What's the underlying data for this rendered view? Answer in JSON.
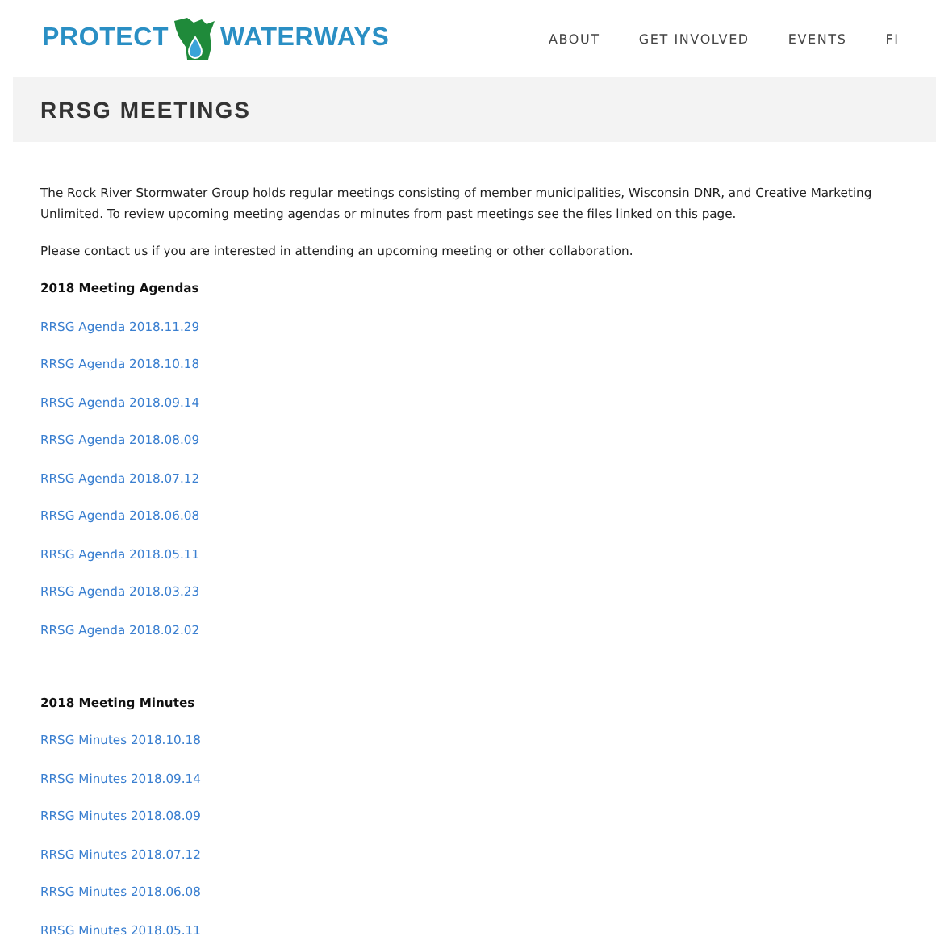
{
  "header": {
    "logo_left": "PROTECT",
    "logo_right": "WATERWAYS",
    "nav": [
      "ABOUT",
      "GET INVOLVED",
      "EVENTS",
      "FI"
    ]
  },
  "page_title": "RRSG MEETINGS",
  "intro": "The Rock River Stormwater Group holds regular meetings consisting of member municipalities, Wisconsin DNR, and Creative Marketing Unlimited. To review upcoming meeting agendas or minutes from past meetings see the files linked on this page.",
  "contact": "Please contact us if you are interested in attending an upcoming meeting or other collaboration.",
  "sections": [
    {
      "heading": "2018 Meeting Agendas",
      "links": [
        "RRSG Agenda 2018.11.29",
        "RRSG Agenda 2018.10.18",
        "RRSG Agenda 2018.09.14",
        "RRSG Agenda 2018.08.09",
        "RRSG Agenda 2018.07.12",
        "RRSG Agenda 2018.06.08",
        "RRSG Agenda 2018.05.11",
        "RRSG Agenda 2018.03.23",
        "RRSG Agenda 2018.02.02"
      ]
    },
    {
      "heading": "2018 Meeting Minutes",
      "links": [
        "RRSG Minutes 2018.10.18",
        "RRSG Minutes 2018.09.14",
        "RRSG Minutes 2018.08.09",
        "RRSG Minutes 2018.07.12",
        "RRSG Minutes 2018.06.08",
        "RRSG Minutes 2018.05.11"
      ]
    }
  ]
}
